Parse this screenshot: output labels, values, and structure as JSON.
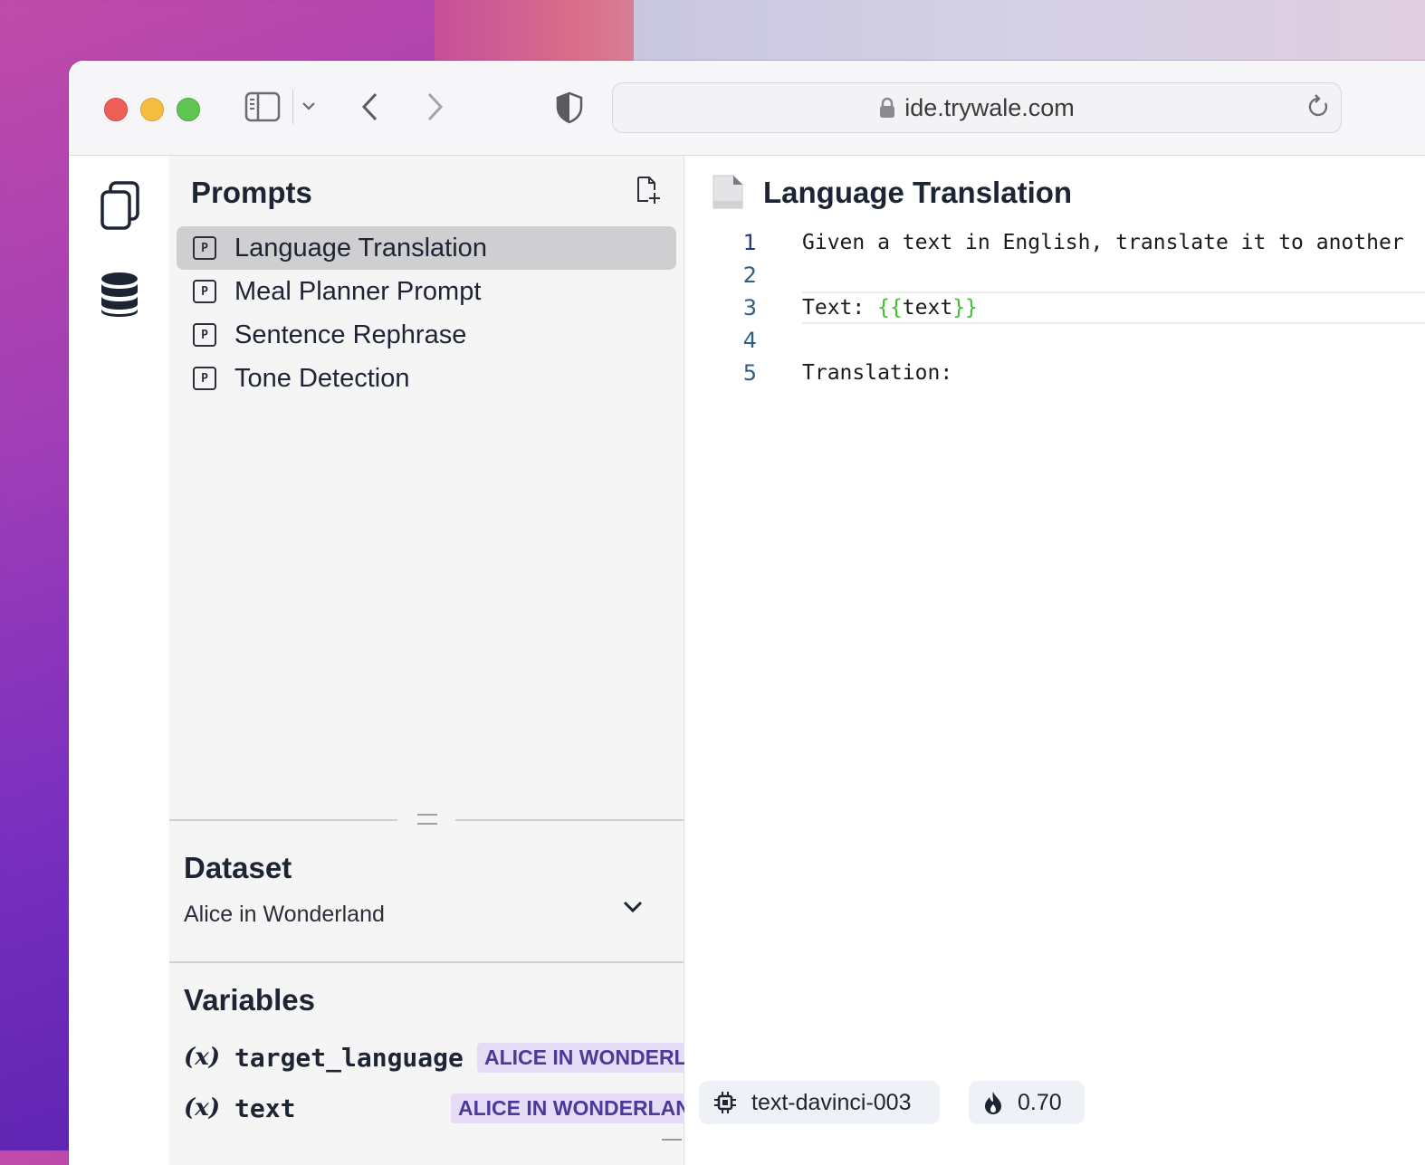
{
  "browser": {
    "url": "ide.trywale.com"
  },
  "sidebar": {
    "title": "Prompts",
    "prompts": [
      {
        "label": "Language Translation",
        "active": true
      },
      {
        "label": "Meal Planner Prompt"
      },
      {
        "label": "Sentence Rephrase"
      },
      {
        "label": "Tone Detection"
      }
    ],
    "prompt_icon_letter": "P"
  },
  "dataset": {
    "title": "Dataset",
    "selected": "Alice in Wonderland"
  },
  "variables": {
    "title": "Variables",
    "symbol": "(x)",
    "items": [
      {
        "name": "target_language",
        "value": "ALICE IN WONDERLAND"
      },
      {
        "name": "text",
        "value": "ALICE IN WONDERLAND"
      }
    ]
  },
  "editor": {
    "title": "Language Translation",
    "lines": [
      {
        "num": "1",
        "text": "Given a text in English, translate it to another"
      },
      {
        "num": "2",
        "text": ""
      },
      {
        "num": "3",
        "prefix": "Text: ",
        "open": "{{",
        "var": "text",
        "close": "}}"
      },
      {
        "num": "4",
        "text": ""
      },
      {
        "num": "5",
        "text": "Translation:"
      }
    ]
  },
  "settings": {
    "model": "text-davinci-003",
    "temperature": "0.70"
  },
  "colors": {
    "accent_brace": "#3fbf2f",
    "badge_bg": "#e7dcf7",
    "badge_text": "#4a3a9a",
    "line_number": "#2f5f84"
  }
}
